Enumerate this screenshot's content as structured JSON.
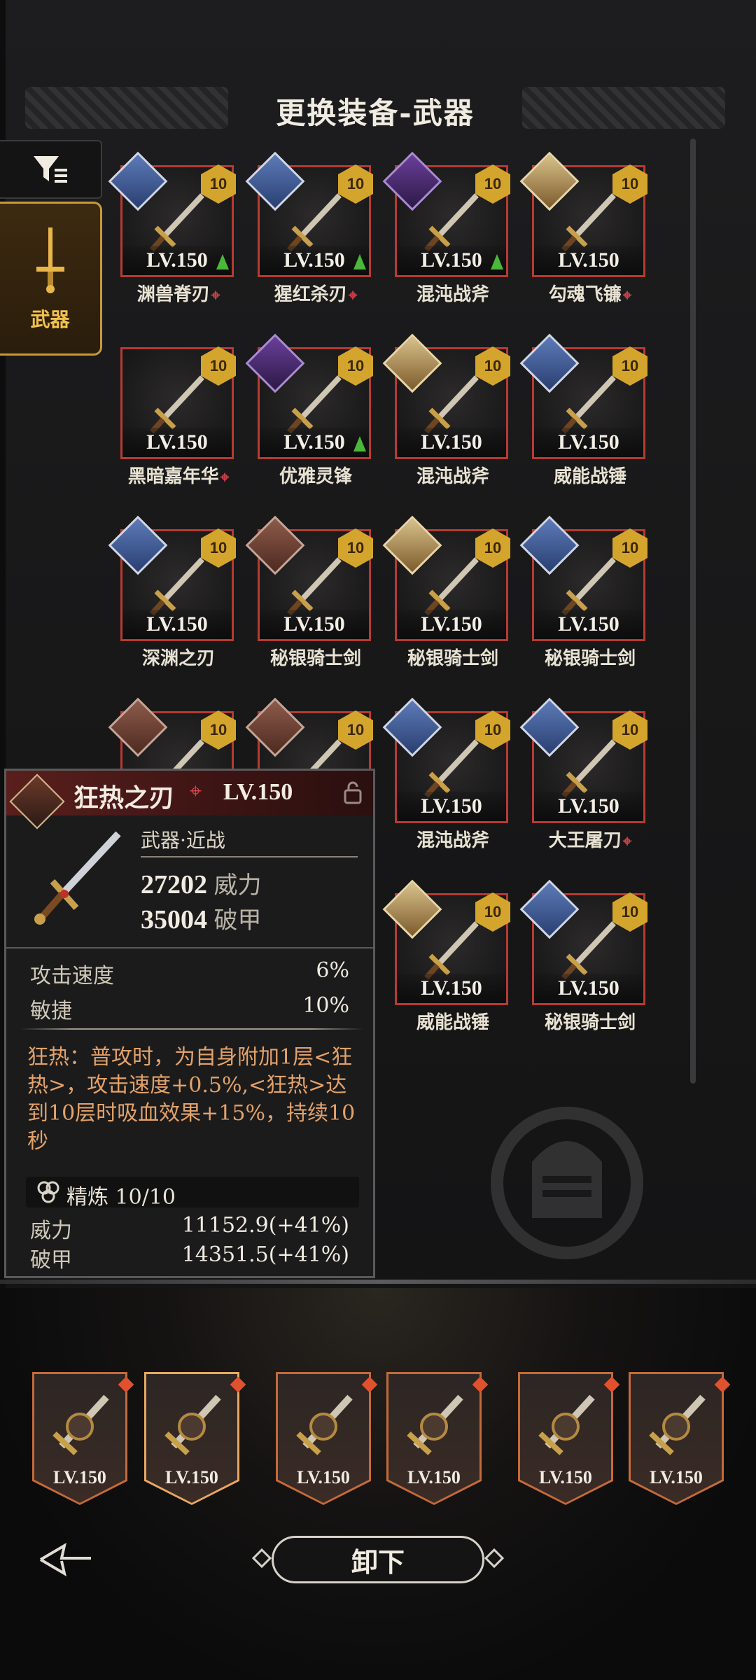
{
  "header": {
    "title": "更换装备-武器"
  },
  "sidebar": {
    "filter_icon": "filter-icon",
    "weapon_tab": "武器"
  },
  "grid": {
    "items": [
      {
        "name": "渊兽脊刃",
        "level": "LV.150",
        "badge": "10",
        "upgrade": true,
        "marker": true,
        "portrait": "blue"
      },
      {
        "name": "猩红杀刃",
        "level": "LV.150",
        "badge": "10",
        "upgrade": true,
        "marker": true,
        "portrait": "blue"
      },
      {
        "name": "混沌战斧",
        "level": "LV.150",
        "badge": "10",
        "upgrade": true,
        "marker": false,
        "portrait": "purple"
      },
      {
        "name": "勾魂飞镰",
        "level": "LV.150",
        "badge": "10",
        "upgrade": false,
        "marker": true,
        "portrait": "gold"
      },
      {
        "name": "黑暗嘉年华",
        "level": "LV.150",
        "badge": "10",
        "upgrade": false,
        "marker": true,
        "portrait": ""
      },
      {
        "name": "优雅灵锋",
        "level": "LV.150",
        "badge": "10",
        "upgrade": true,
        "marker": false,
        "portrait": "purple"
      },
      {
        "name": "混沌战斧",
        "level": "LV.150",
        "badge": "10",
        "upgrade": false,
        "marker": false,
        "portrait": "gold"
      },
      {
        "name": "威能战锤",
        "level": "LV.150",
        "badge": "10",
        "upgrade": false,
        "marker": false,
        "portrait": "blue"
      },
      {
        "name": "深渊之刃",
        "level": "LV.150",
        "badge": "10",
        "upgrade": false,
        "marker": false,
        "portrait": "blue"
      },
      {
        "name": "秘银骑士剑",
        "level": "LV.150",
        "badge": "10",
        "upgrade": false,
        "marker": false,
        "portrait": "red"
      },
      {
        "name": "秘银骑士剑",
        "level": "LV.150",
        "badge": "10",
        "upgrade": false,
        "marker": false,
        "portrait": "gold"
      },
      {
        "name": "秘银骑士剑",
        "level": "LV.150",
        "badge": "10",
        "upgrade": false,
        "marker": false,
        "portrait": "blue"
      },
      {
        "name": "",
        "level": "",
        "badge": "10",
        "upgrade": false,
        "marker": false,
        "portrait": "red"
      },
      {
        "name": "",
        "level": "",
        "badge": "10",
        "upgrade": false,
        "marker": false,
        "portrait": "red"
      },
      {
        "name": "混沌战斧",
        "level": "LV.150",
        "badge": "10",
        "upgrade": false,
        "marker": false,
        "portrait": "blue"
      },
      {
        "name": "大王屠刀",
        "level": "LV.150",
        "badge": "10",
        "upgrade": false,
        "marker": true,
        "portrait": "blue"
      },
      {
        "name": "威能战锤",
        "level": "LV.150",
        "badge": "10",
        "upgrade": false,
        "marker": false,
        "portrait": "gold"
      },
      {
        "name": "秘银骑士剑",
        "level": "LV.150",
        "badge": "10",
        "upgrade": false,
        "marker": false,
        "portrait": "blue"
      }
    ]
  },
  "detail": {
    "name": "狂热之刃",
    "level": "LV.150",
    "type": "武器·近战",
    "power_value": "27202",
    "power_label": "威力",
    "armor_break_value": "35004",
    "armor_break_label": "破甲",
    "attack_speed_label": "攻击速度",
    "attack_speed_value": "6%",
    "agility_label": "敏捷",
    "agility_value": "10%",
    "description": "狂热：普攻时，为自身附加1层<狂热>，攻击速度+0.5%,<狂热>达到10层时吸血效果+15%，持续10秒",
    "refine_label": "精炼 10/10",
    "refine_power_label": "威力",
    "refine_power_value": "11152.9(+41%)",
    "refine_armor_label": "破甲",
    "refine_armor_value": "14351.5(+41%)"
  },
  "equipped": {
    "slots": [
      {
        "level": "LV.150",
        "kind": "hammer"
      },
      {
        "level": "LV.150",
        "kind": "sword"
      },
      {
        "level": "LV.150",
        "kind": "armor"
      },
      {
        "level": "LV.150",
        "kind": "chest"
      },
      {
        "level": "LV.150",
        "kind": "ring"
      },
      {
        "level": "LV.150",
        "kind": "axe"
      }
    ]
  },
  "footer": {
    "unequip_label": "卸下"
  },
  "colors": {
    "accent_gold": "#c79a3a",
    "card_border": "#b63b33",
    "upgrade_green": "#4ab839",
    "desc_orange": "#e3a26a",
    "marker_red": "#d8404a"
  }
}
